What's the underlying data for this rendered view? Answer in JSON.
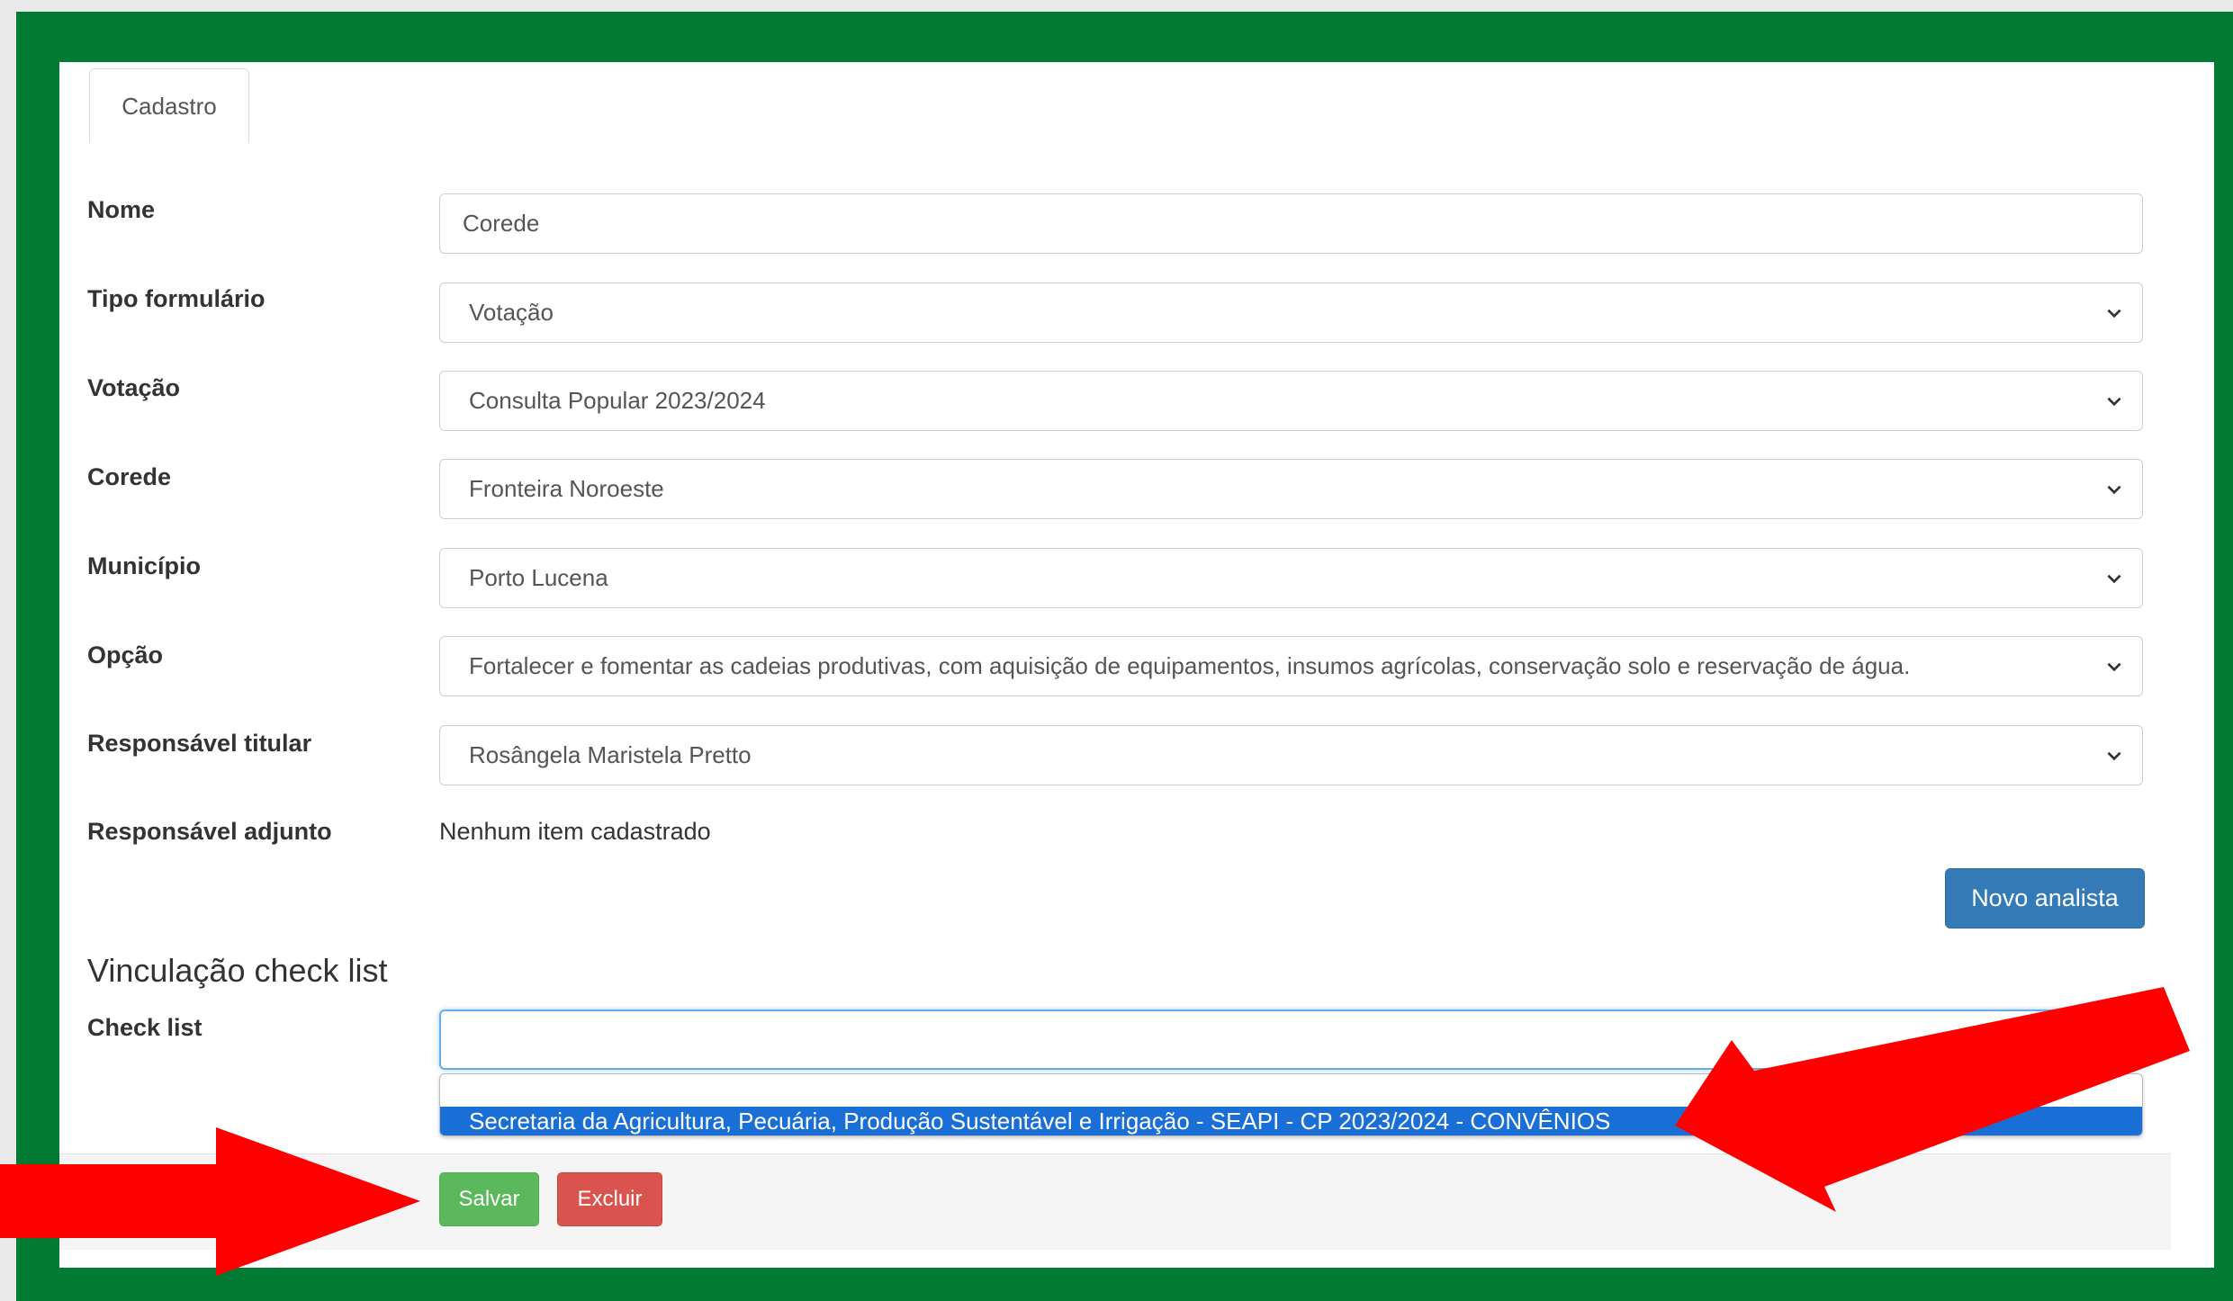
{
  "tab": {
    "label": "Cadastro"
  },
  "form": {
    "nome": {
      "label": "Nome",
      "value": "Corede"
    },
    "tipo": {
      "label": "Tipo formulário",
      "value": "Votação"
    },
    "votacao": {
      "label": "Votação",
      "value": "Consulta Popular 2023/2024"
    },
    "corede": {
      "label": "Corede",
      "value": "Fronteira Noroeste"
    },
    "municipio": {
      "label": "Município",
      "value": "Porto Lucena"
    },
    "opcao": {
      "label": "Opção",
      "value": "Fortalecer e fomentar as cadeias produtivas, com aquisição de equipamentos, insumos agrícolas, conservação solo e reservação de água."
    },
    "titular": {
      "label": "Responsável titular",
      "value": "Rosângela Maristela Pretto"
    },
    "adjunto": {
      "label": "Responsável adjunto",
      "value": "Nenhum item cadastrado"
    }
  },
  "novo_analista": "Novo analista",
  "checklist_section": {
    "title": "Vinculação check list",
    "label": "Check list",
    "value": "",
    "options": [
      "Secretaria da Agricultura, Pecuária, Produção Sustentável e Irrigação - SEAPI - CP 2023/2024 - CONVÊNIOS"
    ]
  },
  "footer": {
    "save_label": "Salvar",
    "delete_label": "Excluir"
  },
  "colors": {
    "frame": "#017a33",
    "arrow": "#ff0000",
    "primary": "#337ab7",
    "success": "#5cb85c",
    "danger": "#d9534f",
    "highlight": "#1a6fd6"
  },
  "icons": [
    "chevron-down-icon",
    "annotation-arrow"
  ]
}
